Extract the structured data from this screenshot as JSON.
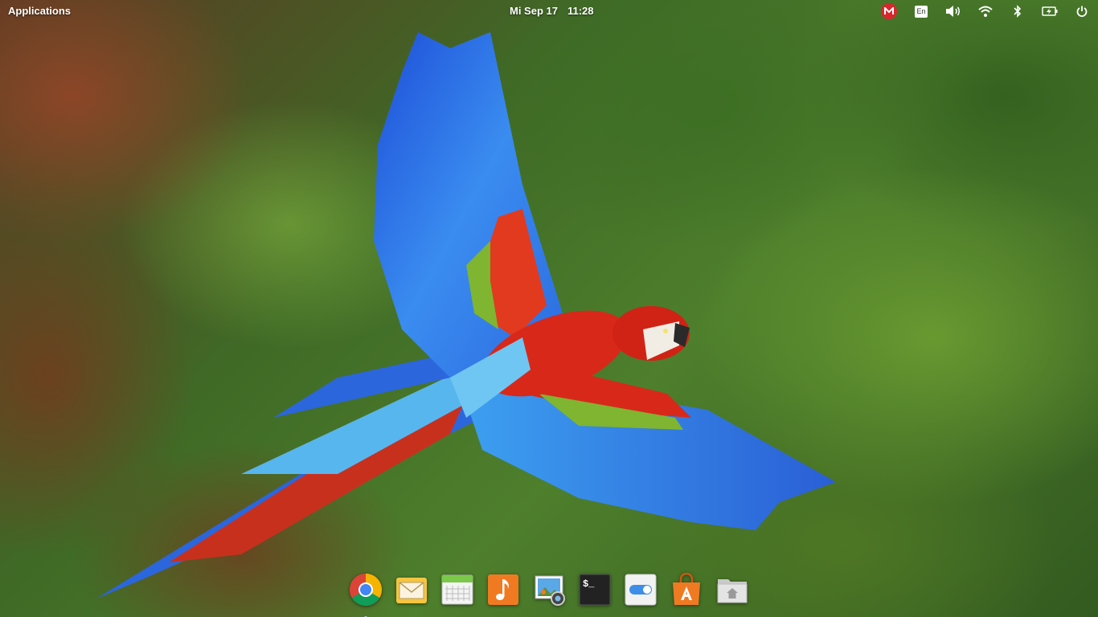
{
  "panel": {
    "applications_label": "Applications",
    "date": "Mi Sep 17",
    "time": "11:28",
    "keyboard_layout": "En",
    "indicators": [
      "mega-icon",
      "keyboard-layout-icon",
      "volume-icon",
      "wifi-icon",
      "bluetooth-icon",
      "battery-icon",
      "power-icon"
    ]
  },
  "dock": {
    "items": [
      {
        "name": "chrome-icon",
        "running": true
      },
      {
        "name": "mail-icon",
        "running": false
      },
      {
        "name": "calendar-icon",
        "running": false
      },
      {
        "name": "music-icon",
        "running": false
      },
      {
        "name": "photos-icon",
        "running": false
      },
      {
        "name": "terminal-icon",
        "running": false
      },
      {
        "name": "settings-toggle-icon",
        "running": false
      },
      {
        "name": "app-center-icon",
        "running": false
      },
      {
        "name": "files-icon",
        "running": false
      }
    ],
    "terminal_glyph": "$_"
  },
  "colors": {
    "mega_red": "#d9272e",
    "parrot_blue": "#2f6fe0",
    "parrot_red": "#d8281a",
    "dock_orange": "#f07a22"
  }
}
